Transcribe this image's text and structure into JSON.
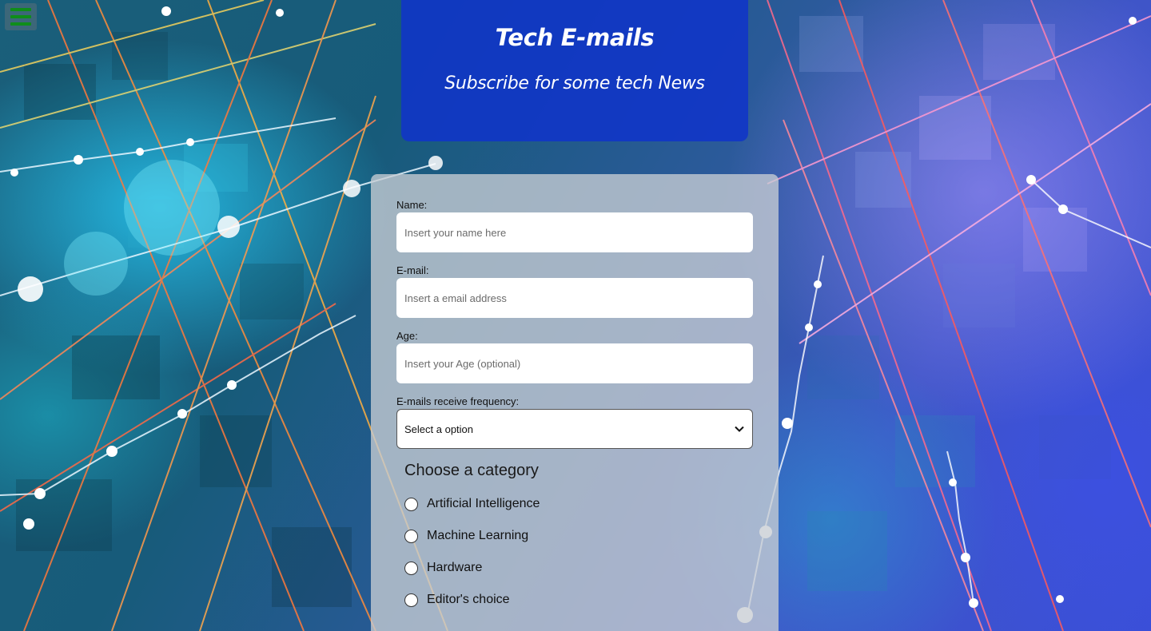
{
  "menu": {
    "icon": "hamburger-menu-icon",
    "color": "#0f8d1a"
  },
  "header": {
    "title": "Tech E-mails",
    "subtitle": "Subscribe for some tech News",
    "background": "#1034c8"
  },
  "form": {
    "name": {
      "label": "Name:",
      "placeholder": "Insert your name here"
    },
    "email": {
      "label": "E-mail:",
      "placeholder": "Insert a email address"
    },
    "age": {
      "label": "Age:",
      "placeholder": "Insert your Age (optional)"
    },
    "frequency": {
      "label": "E-mails receive frequency:",
      "selected": "Select a option",
      "icon": "chevron-down-icon"
    },
    "category": {
      "title": "Choose a category",
      "options": [
        {
          "label": "Artificial Intelligence"
        },
        {
          "label": "Machine Learning"
        },
        {
          "label": "Hardware"
        },
        {
          "label": "Editor's choice"
        }
      ]
    }
  }
}
